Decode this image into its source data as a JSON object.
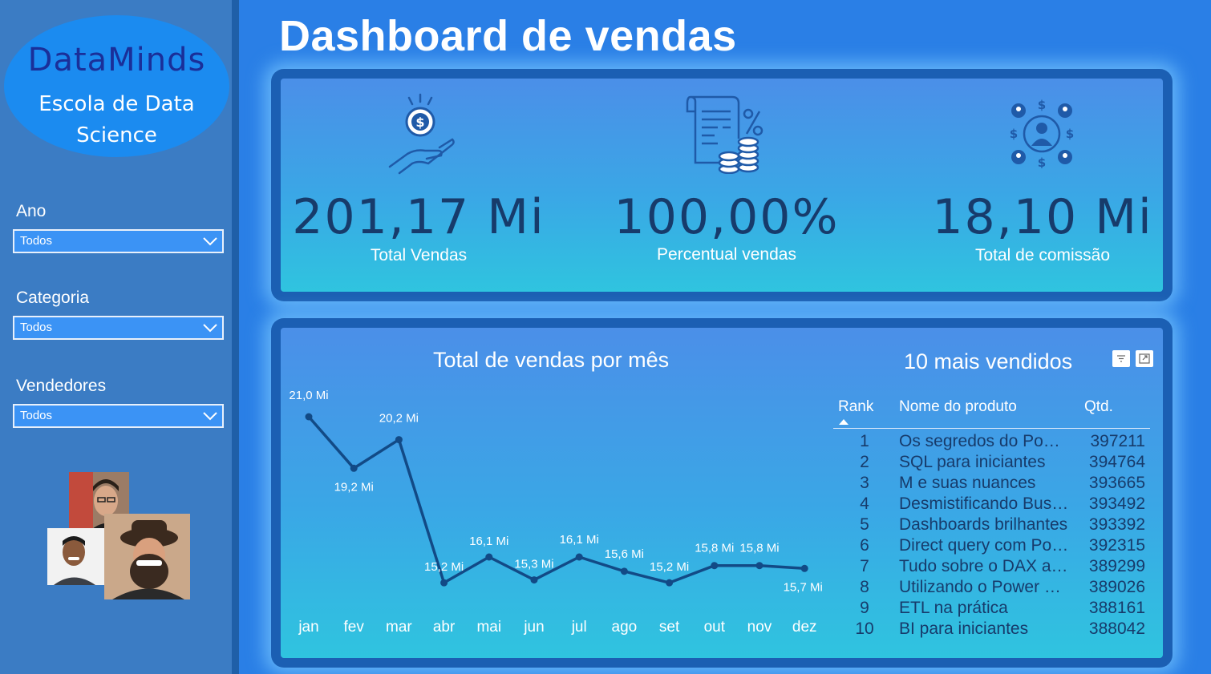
{
  "sidebar": {
    "logo": {
      "title": "DataMinds",
      "subtitle": "Escola de Data Science"
    },
    "filters": [
      {
        "label": "Ano",
        "value": "Todos"
      },
      {
        "label": "Categoria",
        "value": "Todos"
      },
      {
        "label": "Vendedores",
        "value": "Todos"
      }
    ]
  },
  "header": {
    "title": "Dashboard de vendas"
  },
  "kpis": [
    {
      "value": "201,17 Mi",
      "label": "Total Vendas",
      "icon": "money-hand-icon"
    },
    {
      "value": "100,00%",
      "label": "Percentual vendas",
      "icon": "invoice-coins-percent-icon"
    },
    {
      "value": "18,10 Mi",
      "label": "Total de comissão",
      "icon": "people-money-network-icon"
    }
  ],
  "colors": {
    "background": "#2a7fe6",
    "sidebar": "#3b7cc4",
    "panel_frame": "#1b5fb3",
    "line": "#124a86",
    "kpi_value": "#173b6b"
  },
  "chart_data": {
    "type": "line",
    "title": "Total de vendas por mês",
    "categories": [
      "jan",
      "fev",
      "mar",
      "abr",
      "mai",
      "jun",
      "jul",
      "ago",
      "set",
      "out",
      "nov",
      "dez"
    ],
    "values": [
      21.0,
      19.2,
      20.2,
      15.2,
      16.1,
      15.3,
      16.1,
      15.6,
      15.2,
      15.8,
      15.8,
      15.7
    ],
    "labels": [
      "21,0 Mi",
      "19,2 Mi",
      "20,2 Mi",
      "15,2 Mi",
      "16,1 Mi",
      "15,3 Mi",
      "16,1 Mi",
      "15,6 Mi",
      "15,2 Mi",
      "15,8 Mi",
      "15,8 Mi",
      "15,7 Mi"
    ],
    "ylim": [
      14.7,
      21.0
    ],
    "grid": false,
    "legend": "none"
  },
  "top_products": {
    "title": "10 mais vendidos",
    "columns": [
      "Rank",
      "Nome do produto",
      "Qtd."
    ],
    "rows": [
      [
        "1",
        "Os segredos do Power BI",
        "397211"
      ],
      [
        "2",
        "SQL para iniciantes",
        "394764"
      ],
      [
        "3",
        "M e suas nuances",
        "393665"
      ],
      [
        "4",
        "Desmistificando Business Intelligence",
        "393492"
      ],
      [
        "5",
        "Dashboards brilhantes",
        "393392"
      ],
      [
        "6",
        "Direct query com Power BI",
        "392315"
      ],
      [
        "7",
        "Tudo sobre o DAX avançado",
        "389299"
      ],
      [
        "8",
        "Utilizando o Power Query",
        "389026"
      ],
      [
        "9",
        "ETL na prática",
        "388161"
      ],
      [
        "10",
        "BI para iniciantes",
        "388042"
      ]
    ]
  }
}
